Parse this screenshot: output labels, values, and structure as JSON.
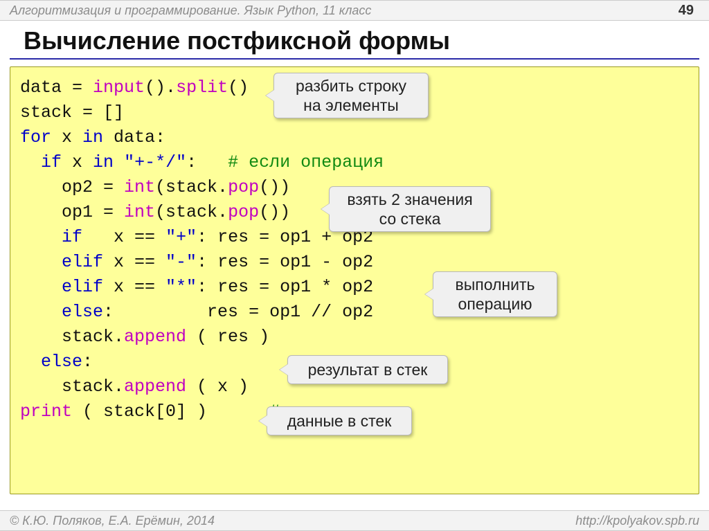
{
  "header": {
    "subject": "Алгоритмизация и программирование. Язык Python, 11 класс",
    "page": "49"
  },
  "title": "Вычисление постфиксной формы",
  "code": {
    "l1a": "data",
    "l1b": " = ",
    "l1c": "input",
    "l1d": "().",
    "l1e": "split",
    "l1f": "()",
    "l2": "stack = []",
    "l3a": "for",
    "l3b": " x ",
    "l3c": "in",
    "l3d": " data:",
    "l4a": "  ",
    "l4b": "if",
    "l4c": " x ",
    "l4d": "in",
    "l4e": " ",
    "l4f": "\"+-*/\"",
    "l4g": ":   ",
    "l4h": "# если операция",
    "l5a": "    op2 = ",
    "l5b": "int",
    "l5c": "(stack.",
    "l5d": "pop",
    "l5e": "())",
    "l6a": "    op1 = ",
    "l6b": "int",
    "l6c": "(stack.",
    "l6d": "pop",
    "l6e": "())",
    "l7a": "    ",
    "l7b": "if",
    "l7c": "   x == ",
    "l7d": "\"+\"",
    "l7e": ": res = op1 + op2",
    "l8a": "    ",
    "l8b": "elif",
    "l8c": " x == ",
    "l8d": "\"-\"",
    "l8e": ": res = op1 - op2",
    "l9a": "    ",
    "l9b": "elif",
    "l9c": " x == ",
    "l9d": "\"*\"",
    "l9e": ": res = op1 * op2",
    "l10a": "    ",
    "l10b": "else",
    "l10c": ":         res = op1 // op2",
    "l11a": "    stack.",
    "l11b": "append",
    "l11c": " ( res )",
    "l12a": "  ",
    "l12b": "else",
    "l12c": ":",
    "l13a": "    stack.",
    "l13b": "append",
    "l13c": " ( x )",
    "l14a": "print",
    "l14b": " ( stack[0] )      ",
    "l14c": "# результат"
  },
  "callouts": {
    "c1a": "разбить строку",
    "c1b": "на элементы",
    "c2a": "взять 2 значения",
    "c2b": "со стека",
    "c3a": "выполнить",
    "c3b": "операцию",
    "c4": "результат в стек",
    "c5": "данные в стек"
  },
  "footer": {
    "left": "© К.Ю. Поляков, Е.А. Ерёмин, 2014",
    "right": "http://kpolyakov.spb.ru"
  }
}
